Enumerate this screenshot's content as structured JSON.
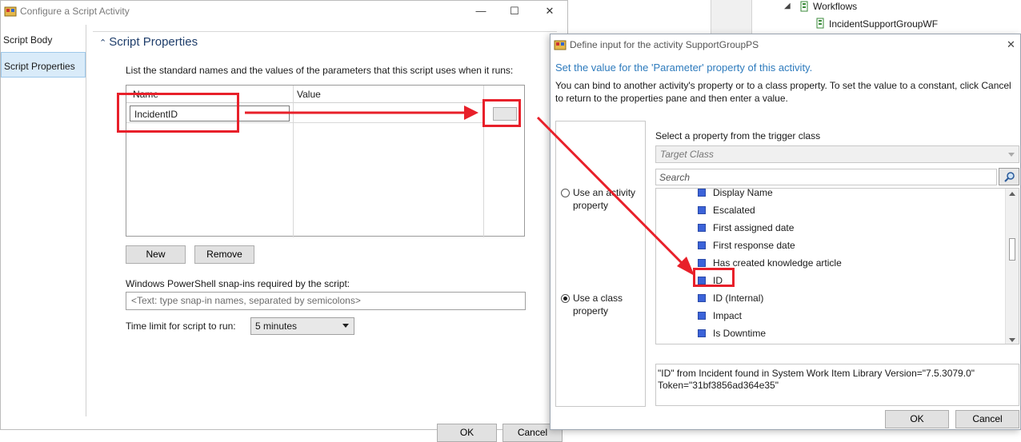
{
  "background_window": {
    "tree": [
      {
        "label": "Workflows"
      },
      {
        "label": "IncidentSupportGroupWF"
      }
    ]
  },
  "config_window": {
    "title": "Configure a Script Activity",
    "controls": {
      "minimize": "—",
      "maximize": "☐",
      "close": "✕"
    },
    "nav": [
      {
        "label": "Script Body"
      },
      {
        "label": "Script Properties"
      }
    ],
    "section_title": "Script Properties",
    "params_instructions": "List the standard names and the values of the parameters that this script uses when it runs:",
    "grid": {
      "columns": [
        "Name",
        "Value"
      ],
      "rows": [
        {
          "name": "IncidentID",
          "value": ""
        }
      ]
    },
    "new_label": "New",
    "remove_label": "Remove",
    "snapins_label": "Windows PowerShell snap-ins required by the script:",
    "snapins_placeholder": "<Text: type snap-in names, separated by semicolons>",
    "time_limit_label": "Time limit for script to run:",
    "time_limit_value": "5 minutes",
    "ok_label": "OK",
    "cancel_label": "Cancel"
  },
  "define_dialog": {
    "title": "Define input for the activity SupportGroupPS",
    "heading": "Set the value for the 'Parameter' property of this activity.",
    "description": "You can bind to another activity's property or to a class property. To set the value to a constant, click Cancel to return to the properties pane and then enter a value.",
    "radio_activity": "Use an activity property",
    "radio_class": "Use a class property",
    "selected_radio": "class",
    "trigger_label": "Select a property from the trigger class",
    "trigger_combo": "Target Class",
    "search_placeholder": "Search",
    "properties": [
      {
        "label": "Display Name"
      },
      {
        "label": "Escalated"
      },
      {
        "label": "First assigned date"
      },
      {
        "label": "First response date"
      },
      {
        "label": "Has created knowledge article"
      },
      {
        "label": "ID"
      },
      {
        "label": "ID (Internal)"
      },
      {
        "label": "Impact"
      },
      {
        "label": "Is Downtime"
      }
    ],
    "selected_property": "ID",
    "property_description": "\"ID\" from Incident found in System Work Item Library Version=\"7.5.3079.0\" Token=\"31bf3856ad364e35\"",
    "ok_label": "OK",
    "cancel_label": "Cancel"
  },
  "colors": {
    "annotation": "#e8202a",
    "heading_blue": "#2e7bbd",
    "nav_selected": "#d9ebf9",
    "property_square": "#3b63d9"
  }
}
